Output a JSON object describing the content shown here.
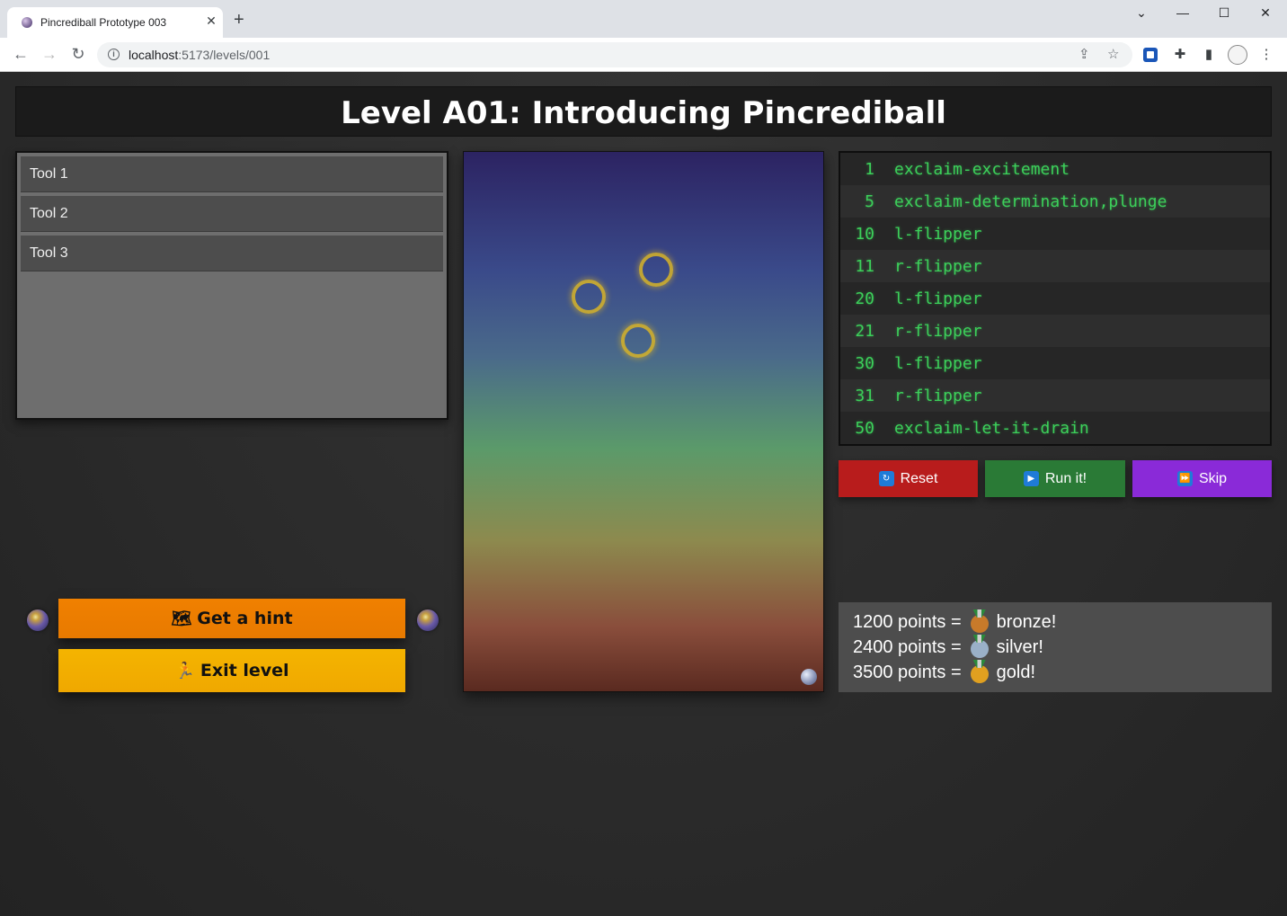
{
  "browser": {
    "tab_title": "Pincrediball Prototype 003",
    "url_host": "localhost",
    "url_path": ":5173/levels/001"
  },
  "level": {
    "title": "Level A01: Introducing Pincrediball"
  },
  "tools": [
    {
      "label": "Tool 1"
    },
    {
      "label": "Tool 2"
    },
    {
      "label": "Tool 3"
    }
  ],
  "program": [
    {
      "line": "1",
      "command": "exclaim-excitement"
    },
    {
      "line": "5",
      "command": "exclaim-determination,plunge"
    },
    {
      "line": "10",
      "command": "l-flipper"
    },
    {
      "line": "11",
      "command": "r-flipper"
    },
    {
      "line": "20",
      "command": "l-flipper"
    },
    {
      "line": "21",
      "command": "r-flipper"
    },
    {
      "line": "30",
      "command": "l-flipper"
    },
    {
      "line": "31",
      "command": "r-flipper"
    },
    {
      "line": "50",
      "command": "exclaim-let-it-drain"
    }
  ],
  "controls": {
    "reset_label": "Reset",
    "run_label": "Run it!",
    "skip_label": "Skip",
    "reset_color": "#b81c1c",
    "run_color": "#2a7a36",
    "skip_color": "#8a2ad8"
  },
  "medals": [
    {
      "points": "1200 points =",
      "name": "bronze!",
      "color": "#c87a2a"
    },
    {
      "points": "2400 points =",
      "name": "silver!",
      "color": "#9ab0c8"
    },
    {
      "points": "3500 points =",
      "name": "gold!",
      "color": "#e0a020"
    }
  ],
  "actions": {
    "hint_label": "Get a hint",
    "exit_label": "Exit level",
    "hint_color": "#f08000",
    "exit_color": "#f4b400"
  }
}
